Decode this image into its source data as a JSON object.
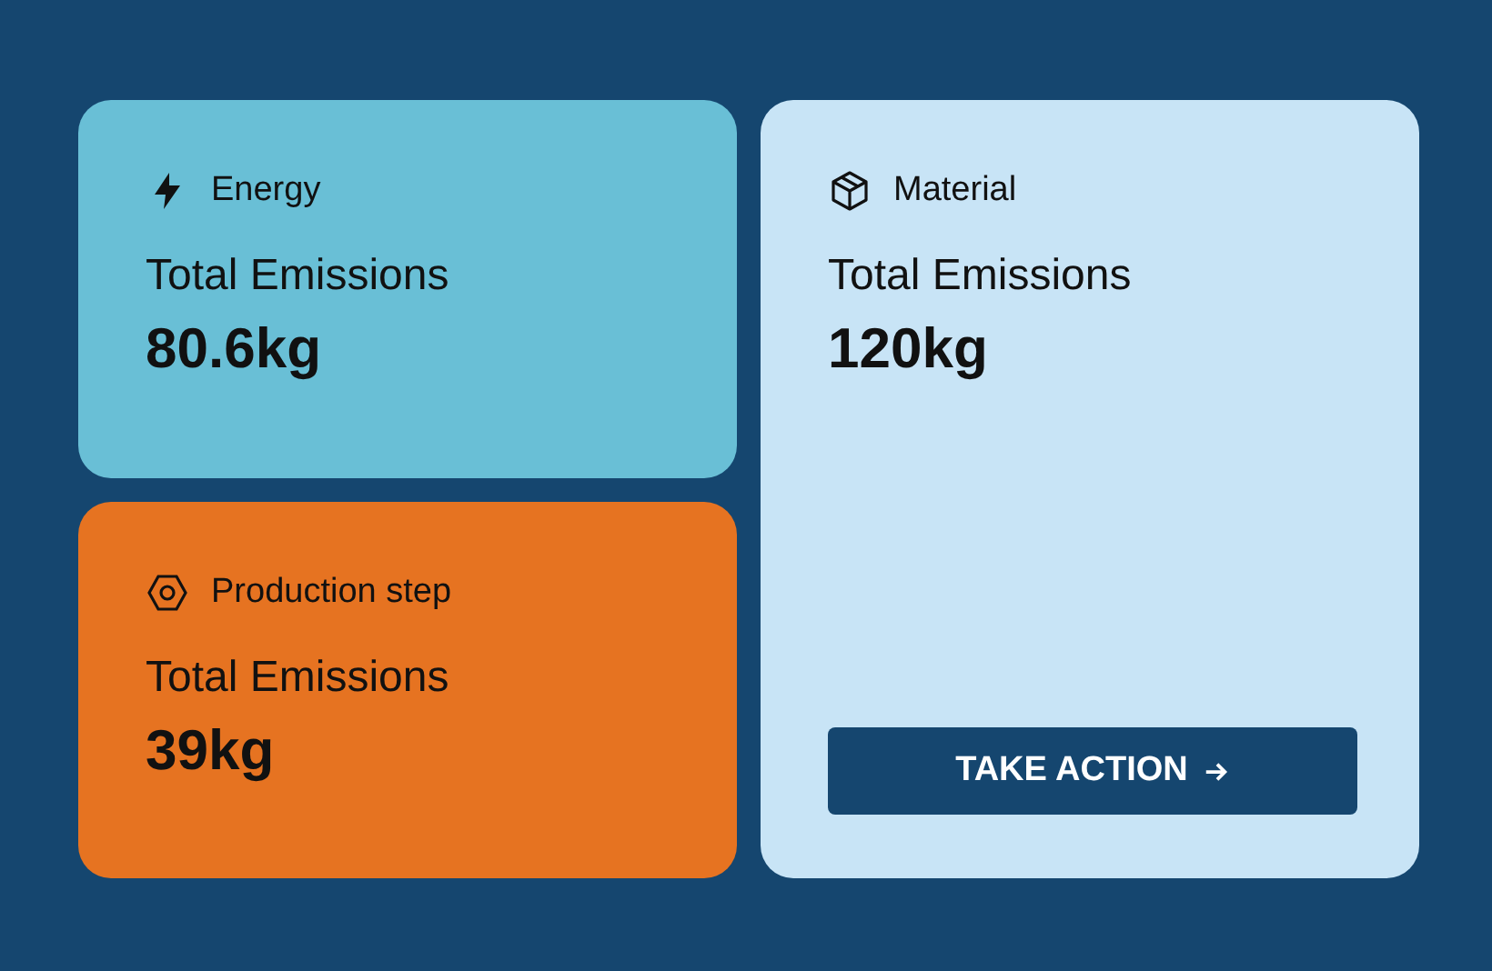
{
  "cards": [
    {
      "kind": "energy",
      "color": "#69bfd6",
      "label": "Energy",
      "metric": "Total Emissions",
      "value": "80.6kg"
    },
    {
      "kind": "production",
      "color": "#e67321",
      "label": "Production step",
      "metric": "Total Emissions",
      "value": "39kg"
    },
    {
      "kind": "material",
      "color": "#c8e4f6",
      "label": "Material",
      "metric": "Total Emissions",
      "value": "120kg",
      "button": "TAKE ACTION"
    }
  ]
}
